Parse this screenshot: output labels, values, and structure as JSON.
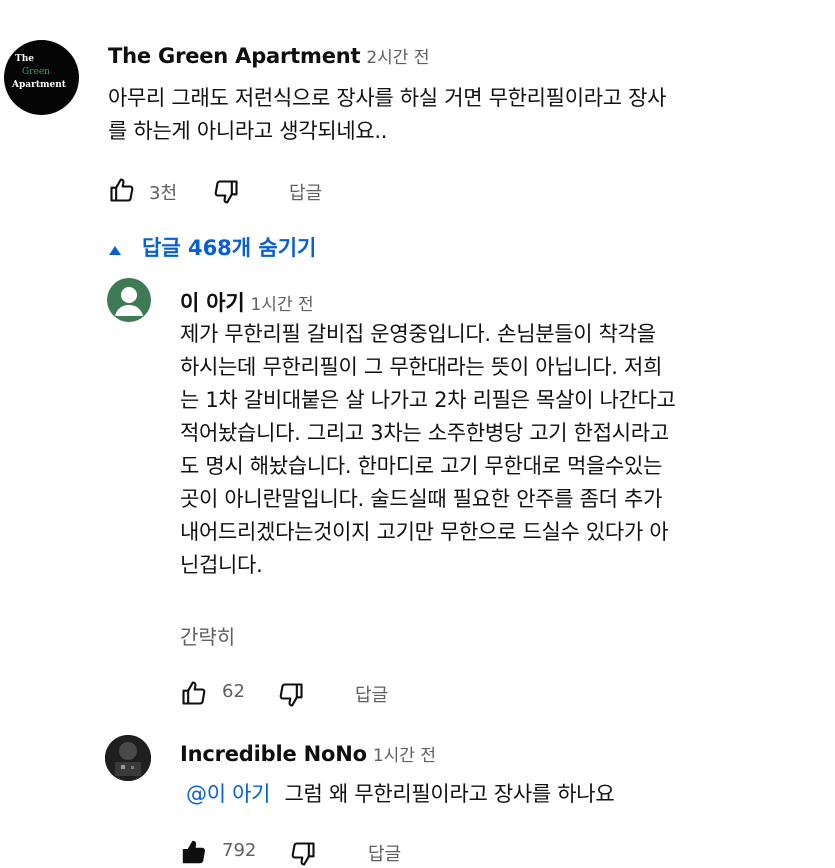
{
  "comment": {
    "avatar_text": [
      "The",
      "Green",
      "Apartment"
    ],
    "author": "The Green Apartment",
    "time": "2시간 전",
    "lines": [
      "아무리 그래도 저런식으로 장사를 하실 거면 무한리필이라고 장사",
      "를 하는게 아니라고 생각되네요.."
    ],
    "likes": "3천",
    "reply_label": "답글",
    "toggle_label": "답글 468개 숨기기"
  },
  "reply1": {
    "author": "이 아기",
    "time": "1시간 전",
    "lines": [
      "제가 무한리필 갈비집 운영중입니다. 손님분들이 착각을",
      "하시는데 무한리필이 그 무한대라는 뜻이 아닙니다. 저희",
      "는 1차 갈비대붙은 살 나가고 2차 리필은 목살이 나간다고",
      "적어놨습니다. 그리고 3차는 소주한병당 고기 한접시라고",
      "도 명시 해놨습니다. 한마디로 고기 무한대로 먹을수있는",
      "곳이 아니란말입니다. 술드실때 필요한 안주를 좀더 추가",
      "내어드리겠다는것이지 고기만 무한으로 드실수 있다가 아",
      "닌겁니다."
    ],
    "collapse_label": "간략히",
    "likes": "62",
    "reply_label": "답글"
  },
  "reply2": {
    "author": "Incredible NoNo",
    "time": "1시간 전",
    "mention": "@이 아기",
    "text": "그럼 왜 무한리필이라고 장사를 하나요",
    "likes": "792",
    "reply_label": "답글"
  },
  "colors": {
    "link": "#065fd4",
    "muted": "#606060",
    "default_avatar": "#3d7a55"
  }
}
